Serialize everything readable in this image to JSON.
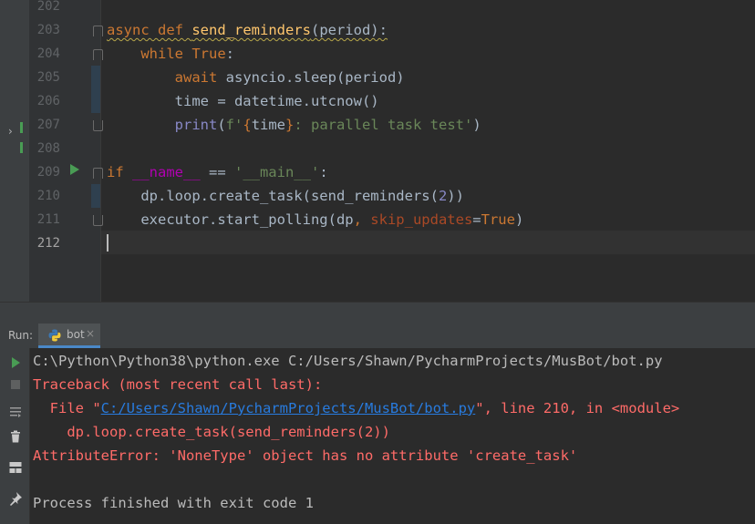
{
  "editor": {
    "line_numbers": [
      "202",
      "203",
      "204",
      "205",
      "206",
      "207",
      "208",
      "209",
      "210",
      "211",
      "212"
    ],
    "lines": [
      {
        "segments": []
      },
      {
        "segments": [
          {
            "t": "async ",
            "c": "kw wavy"
          },
          {
            "t": "def ",
            "c": "kw wavy"
          },
          {
            "t": "send_reminders",
            "c": "fn wavy"
          },
          {
            "t": "(period):",
            "c": "wavy"
          }
        ]
      },
      {
        "segments": [
          {
            "t": "    "
          },
          {
            "t": "while ",
            "c": "kw"
          },
          {
            "t": "True",
            "c": "kw"
          },
          {
            "t": ":"
          }
        ]
      },
      {
        "segments": [
          {
            "t": "        "
          },
          {
            "t": "await ",
            "c": "kw"
          },
          {
            "t": "asyncio.sleep(period)"
          }
        ]
      },
      {
        "segments": [
          {
            "t": "        time = datetime.utcnow()"
          }
        ]
      },
      {
        "segments": [
          {
            "t": "        "
          },
          {
            "t": "print",
            "c": "bi"
          },
          {
            "t": "("
          },
          {
            "t": "f'",
            "c": "str"
          },
          {
            "t": "{",
            "c": "kw"
          },
          {
            "t": "time"
          },
          {
            "t": "}",
            "c": "kw"
          },
          {
            "t": ": parallel task test'",
            "c": "str"
          },
          {
            "t": ")"
          }
        ]
      },
      {
        "segments": []
      },
      {
        "segments": [
          {
            "t": "if ",
            "c": "kw"
          },
          {
            "t": "__name__",
            "c": "dunder"
          },
          {
            "t": " == "
          },
          {
            "t": "'__main__'",
            "c": "str"
          },
          {
            "t": ":"
          }
        ]
      },
      {
        "segments": [
          {
            "t": "    dp.loop.create_task(send_reminders("
          },
          {
            "t": "2",
            "c": "bi"
          },
          {
            "t": "))"
          }
        ]
      },
      {
        "segments": [
          {
            "t": "    executor.start_polling(dp"
          },
          {
            "t": ", ",
            "c": "kw"
          },
          {
            "t": "skip_updates",
            "c": "param"
          },
          {
            "t": "="
          },
          {
            "t": "True",
            "c": "kw"
          },
          {
            "t": ")"
          }
        ]
      },
      {
        "segments": []
      }
    ]
  },
  "run_panel": {
    "label": "Run:",
    "tab_label": "bot",
    "tab_close": "×"
  },
  "console": {
    "lines": [
      {
        "segments": [
          {
            "t": "C:\\Python\\Python38\\python.exe C:/Users/Shawn/PycharmProjects/MusBot/bot.py"
          }
        ]
      },
      {
        "segments": [
          {
            "t": "Traceback (most recent call last):",
            "c": "err"
          }
        ]
      },
      {
        "segments": [
          {
            "t": "  File \"",
            "c": "err"
          },
          {
            "t": "C:/Users/Shawn/PycharmProjects/MusBot/bot.py",
            "c": "link"
          },
          {
            "t": "\", line 210, in <module>",
            "c": "err"
          }
        ]
      },
      {
        "segments": [
          {
            "t": "    dp.loop.create_task(send_reminders(2))",
            "c": "err"
          }
        ]
      },
      {
        "segments": [
          {
            "t": "AttributeError: 'NoneType' object has no attribute 'create_task'",
            "c": "err"
          }
        ]
      },
      {
        "segments": []
      },
      {
        "segments": [
          {
            "t": "Process finished with exit code 1"
          }
        ]
      }
    ]
  },
  "colors": {
    "editor_bg": "#2b2b2b",
    "gutter_bg": "#313335",
    "keyword": "#cc7832",
    "function": "#ffc66d",
    "string": "#6a8759",
    "builtin": "#8888c6",
    "dunder": "#b200b2",
    "error_text": "#ff6b68",
    "link": "#287bde",
    "run_green": "#499c54"
  }
}
